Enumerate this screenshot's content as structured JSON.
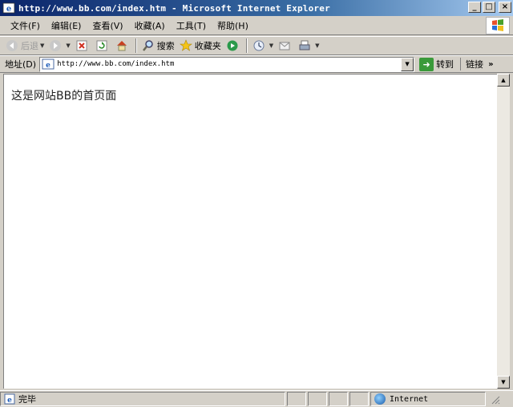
{
  "window": {
    "title": "http://www.bb.com/index.htm - Microsoft Internet Explorer",
    "minimize": "_",
    "maximize": "□",
    "close": "×"
  },
  "menu": [
    "文件(F)",
    "编辑(E)",
    "查看(V)",
    "收藏(A)",
    "工具(T)",
    "帮助(H)"
  ],
  "toolbar": {
    "back_label": "后退",
    "search_label": "搜索",
    "favorites_label": "收藏夹"
  },
  "address": {
    "label": "地址(D)",
    "url": "http://www.bb.com/index.htm",
    "go_label": "转到",
    "links_label": "链接"
  },
  "page": {
    "text": "这是网站BB的首页面"
  },
  "status": {
    "text": "完毕",
    "zone": "Internet"
  },
  "icons": [
    "ie-icon",
    "windows-logo-icon",
    "back-icon",
    "forward-icon",
    "stop-icon",
    "refresh-icon",
    "home-icon",
    "search-icon",
    "favorites-icon",
    "media-icon",
    "history-icon",
    "mail-icon",
    "print-icon",
    "edit-icon",
    "page-icon",
    "go-icon",
    "globe-icon"
  ],
  "colors": {
    "titlebar": "#0a246a",
    "chrome": "#d4d0c8",
    "content": "#ffffff"
  }
}
